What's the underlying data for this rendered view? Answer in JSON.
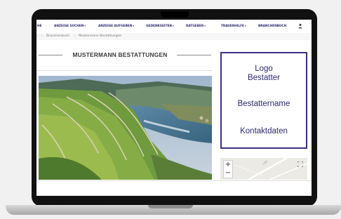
{
  "nav": {
    "items": [
      {
        "label": "HE",
        "caret": ""
      },
      {
        "label": "ANZEIGE SUCHEN",
        "caret": "▾"
      },
      {
        "label": "ANZEIGE AUFGEBEN",
        "caret": "▾"
      },
      {
        "label": "GEDENKSEITEN",
        "caret": "▾"
      },
      {
        "label": "RATGEBER",
        "caret": "▾"
      },
      {
        "label": "TRAUERHILFE",
        "caret": "▾"
      },
      {
        "label": "BRANCHENBUCH",
        "caret": ""
      }
    ],
    "user_icon": "user-icon",
    "color": "#2d2a6e"
  },
  "breadcrumb": {
    "sep1": "›",
    "sep2": "›",
    "item1": "Branchenbuch",
    "sep3": "›",
    "item2": "Mustermann Bestattungen"
  },
  "page": {
    "title": "MUSTERMANN BESTATTUNGEN"
  },
  "info_box": {
    "logo_line1": "Logo",
    "logo_line2": "Bestatter",
    "name": "Bestattername",
    "contact": "Kontaktdaten",
    "border_color": "#3d2f86"
  },
  "map": {
    "zoom_in": "+",
    "zoom_out": "−",
    "road_label": "L50",
    "fullscreen_icon": "fullscreen-icon"
  }
}
